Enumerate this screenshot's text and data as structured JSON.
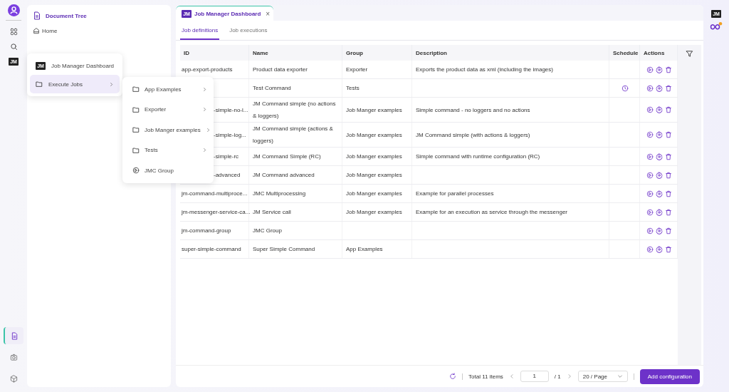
{
  "rail": {
    "top": [
      {
        "kind": "apps"
      },
      {
        "kind": "search"
      },
      {
        "kind": "jm",
        "label": "JM"
      }
    ],
    "bottom": [
      {
        "kind": "document",
        "selected": true
      },
      {
        "kind": "camera",
        "selected": false
      },
      {
        "kind": "cube",
        "selected": false
      }
    ]
  },
  "sidebar": {
    "title": "Document Tree",
    "items": [
      {
        "label": "Home"
      }
    ]
  },
  "menu": {
    "items": [
      {
        "kind": "jm",
        "badge": "JM",
        "label": "Job Manager Dashboard",
        "selected": false,
        "has_submenu": false
      },
      {
        "kind": "folder",
        "label": "Execute Jobs",
        "selected": true,
        "has_submenu": true
      }
    ],
    "submenu": [
      {
        "kind": "folder",
        "label": "App Examples",
        "has_submenu": true
      },
      {
        "kind": "folder",
        "label": "Exporter",
        "has_submenu": true
      },
      {
        "kind": "folder",
        "label": "Job Manger examples",
        "has_submenu": true
      },
      {
        "kind": "folder",
        "label": "Tests",
        "has_submenu": true
      },
      {
        "kind": "play",
        "label": "JMC Group",
        "has_submenu": false
      }
    ]
  },
  "tab": {
    "badge": "JM",
    "title": "Job Manager Dashboard",
    "close": "×"
  },
  "subtabs": [
    {
      "label": "Job definitions",
      "selected": true
    },
    {
      "label": "Job executions",
      "selected": false
    }
  ],
  "table": {
    "columns": [
      "ID",
      "Name",
      "Group",
      "Description",
      "Schedule",
      "Actions"
    ],
    "rows": [
      {
        "id": "app-export-products",
        "id_obscured": false,
        "name": "Product data exporter",
        "group": "Exporter",
        "description": "Exports the product data as xml (including the images)",
        "scheduled": false
      },
      {
        "id_obscured": true,
        "name": "Test Command",
        "group": "Tests",
        "scheduled": true
      },
      {
        "id": "-simple-no-l...",
        "id_obscured": true,
        "name": "JM Command simple (no actions & loggers)",
        "group": "Job Manger examples",
        "description": "Simple command - no loggers and no actions",
        "scheduled": false
      },
      {
        "id": "-simple-log...",
        "id_obscured": true,
        "name": "JM Command simple (actions & loggers)",
        "group": "Job Manger examples",
        "description": "JM Command simple (with actions & loggers)",
        "scheduled": false
      },
      {
        "id": "-simple-rc",
        "id_obscured": true,
        "name": "JM Command Simple (RC)",
        "group": "Job Manger examples",
        "description": "Simple command with runtime configuration (RC)",
        "scheduled": false
      },
      {
        "id": "-advanced",
        "id_obscured": true,
        "name": "JM Command advanced",
        "group": "Job Manger examples",
        "scheduled": false
      },
      {
        "id": "jm-command-multiproce...",
        "id_obscured": false,
        "name": "JMC Multiprocessing",
        "group": "Job Manger examples",
        "description": "Example for parallel processes",
        "scheduled": false
      },
      {
        "id": "jm-messenger-service-ca...",
        "id_obscured": false,
        "name": "JM Service call",
        "group": "Job Manger examples",
        "description": "Example for an execution as service through the messenger",
        "scheduled": false
      },
      {
        "id": "jm-command-group",
        "id_obscured": false,
        "name": "JMC Group",
        "scheduled": false
      },
      {
        "id": "super-simple-command",
        "id_obscured": false,
        "name": "Super Simple Command",
        "group": "App Examples",
        "scheduled": false
      }
    ]
  },
  "footer": {
    "total": "Total 11 items",
    "page": "1",
    "page_count": "/ 1",
    "page_size": "20 / Page",
    "button": "Add configuration"
  },
  "right_rail": {
    "badge": "JM"
  }
}
